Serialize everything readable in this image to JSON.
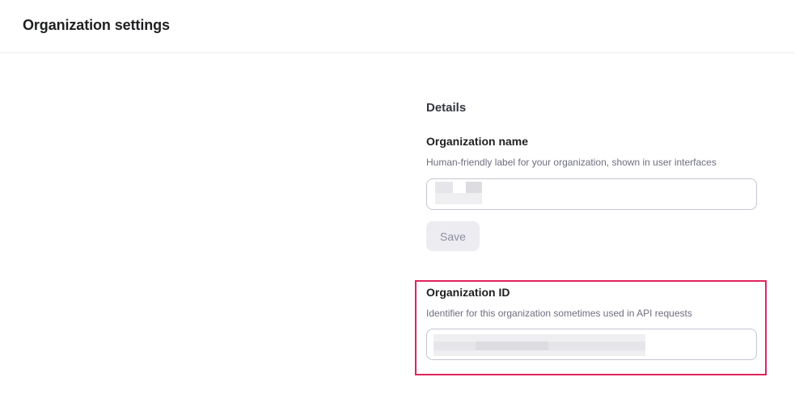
{
  "header": {
    "title": "Organization settings"
  },
  "details": {
    "section_title": "Details",
    "org_name": {
      "label": "Organization name",
      "help": "Human-friendly label for your organization, shown in user interfaces",
      "value": ""
    },
    "save_label": "Save",
    "org_id": {
      "label": "Organization ID",
      "help": "Identifier for this organization sometimes used in API requests",
      "value": ""
    }
  },
  "colors": {
    "highlight": "#e0245e",
    "input_border": "#c5c5d2",
    "disabled_button_bg": "#ececf1"
  }
}
